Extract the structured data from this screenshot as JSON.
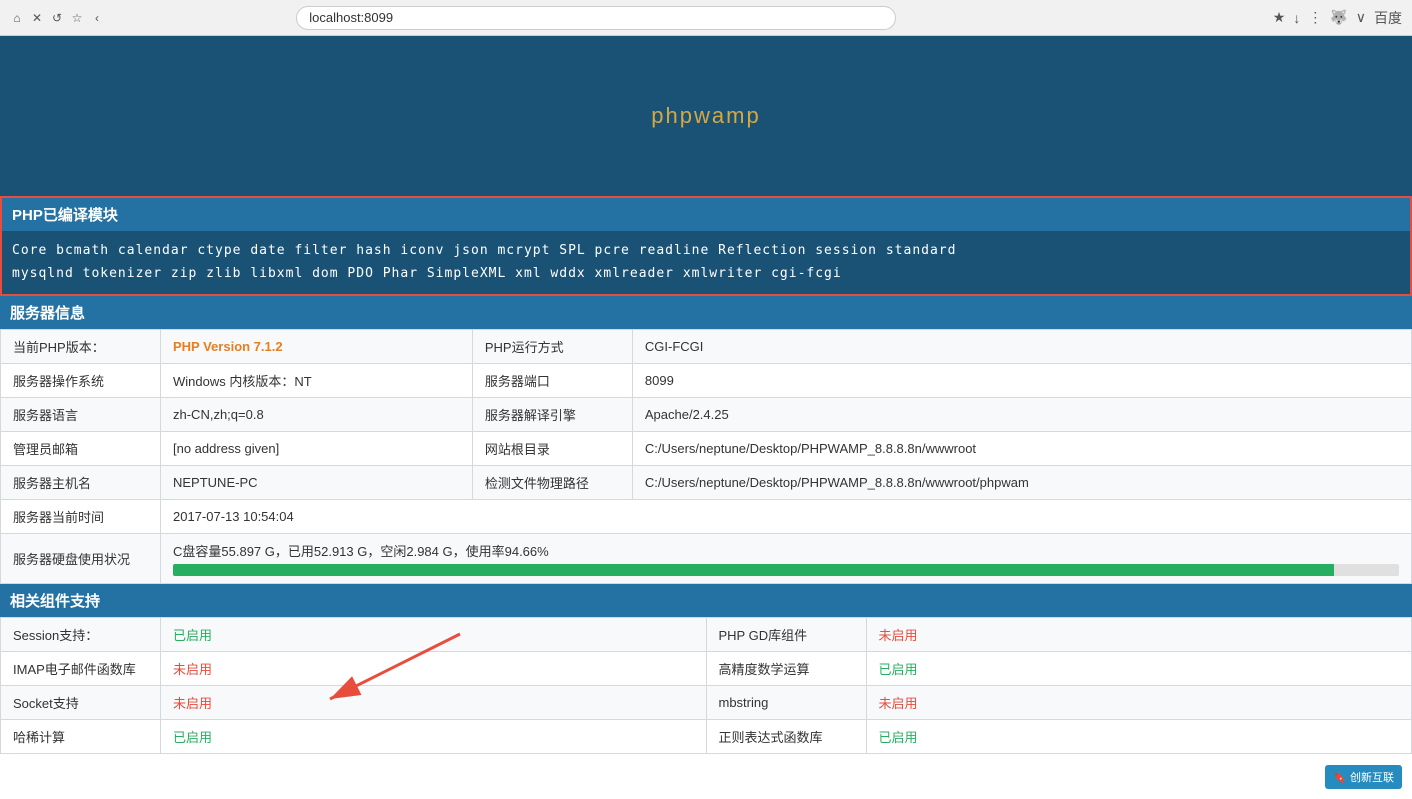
{
  "browser": {
    "url": "localhost:8099",
    "search_engine": "百度"
  },
  "header": {
    "title": "phpwamp"
  },
  "php_modules": {
    "section_title": "PHP已编译模块",
    "line1": "Core  bcmath  calendar  ctype  date  filter  hash  iconv  json  mcrypt  SPL  pcre  readline  Reflection  session  standard",
    "line2": "mysqlnd  tokenizer  zip  zlib  libxml  dom  PDO  Phar  SimpleXML  xml  wddx  xmlreader  xmlwriter  cgi-fcgi"
  },
  "server_info": {
    "section_title": "服务器信息",
    "rows": [
      {
        "left_label": "当前PHP版本：",
        "left_value": "PHP Version 7.1.2",
        "left_value_type": "php-version",
        "right_label": "PHP运行方式",
        "right_value": "CGI-FCGI"
      },
      {
        "left_label": "服务器操作系统",
        "left_value": "Windows  内核版本：NT",
        "right_label": "服务器端口",
        "right_value": "8099"
      },
      {
        "left_label": "服务器语言",
        "left_value": "zh-CN,zh;q=0.8",
        "right_label": "服务器解译引擎",
        "right_value": "Apache/2.4.25"
      },
      {
        "left_label": "管理员邮箱",
        "left_value": "[no address given]",
        "right_label": "网站根目录",
        "right_value": "C:/Users/neptune/Desktop/PHPWAMP_8.8.8.8n/wwwroot"
      },
      {
        "left_label": "服务器主机名",
        "left_value": "NEPTUNE-PC",
        "right_label": "检测文件物理路径",
        "right_value": "C:/Users/neptune/Desktop/PHPWAMP_8.8.8.8n/wwwroot/phpwam"
      },
      {
        "left_label": "服务器当前时间",
        "left_value": "2017-07-13 10:54:04",
        "right_label": "",
        "right_value": ""
      },
      {
        "left_label": "服务器硬盘使用状况",
        "left_value": "C盘容量55.897 G，已用52.913 G，空闲2.984 G，使用率94.66%",
        "right_label": "",
        "right_value": "",
        "has_disk_bar": true
      }
    ]
  },
  "components": {
    "section_title": "相关组件支持",
    "rows": [
      {
        "left_label": "Session支持：",
        "left_value": "已启用",
        "left_status": "enabled",
        "right_label": "PHP GD库组件",
        "right_value": "未启用",
        "right_status": "disabled"
      },
      {
        "left_label": "IMAP电子邮件函数库",
        "left_value": "未启用",
        "left_status": "disabled",
        "right_label": "高精度数学运算",
        "right_value": "已启用",
        "right_status": "enabled",
        "has_arrow": true
      },
      {
        "left_label": "Socket支持",
        "left_value": "未启用",
        "left_status": "disabled",
        "right_label": "mbstring",
        "right_value": "未启用",
        "right_status": "disabled"
      },
      {
        "left_label": "哈稀计算",
        "left_value": "已启用",
        "left_status": "enabled",
        "right_label": "正则表达式函数库",
        "right_value": "已启用",
        "right_status": "enabled"
      }
    ]
  },
  "watermark": {
    "text": "🔖 创新互联"
  }
}
